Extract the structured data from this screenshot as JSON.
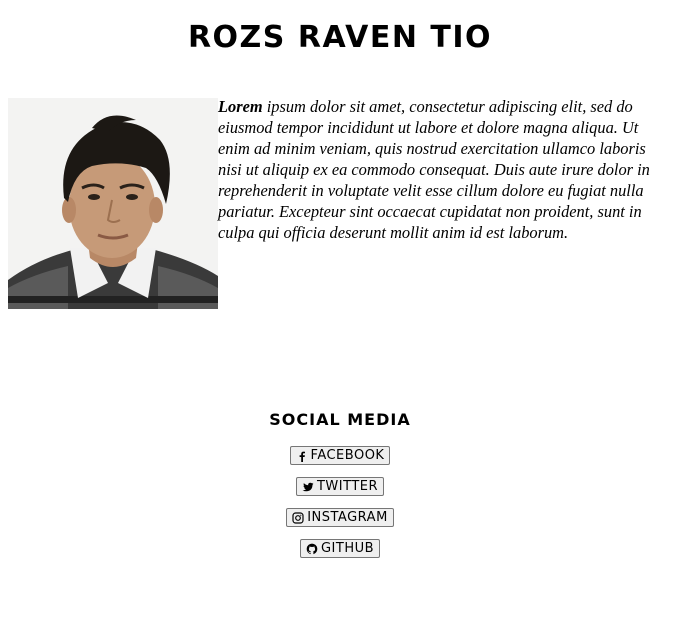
{
  "header": {
    "title": "ROZS RAVEN TIO"
  },
  "profile": {
    "photo_icon": "profile-photo",
    "bio_lead": "Lorem",
    "bio_rest": " ipsum dolor sit amet, consectetur adipiscing elit, sed do eiusmod tempor incididunt ut labore et dolore magna aliqua. Ut enim ad minim veniam, quis nostrud exercitation ullamco laboris nisi ut aliquip ex ea commodo consequat. Duis aute irure dolor in reprehenderit in voluptate velit esse cillum dolore eu fugiat nulla pariatur. Excepteur sint occaecat cupidatat non proident, sunt in culpa qui officia deserunt mollit anim id est laborum."
  },
  "social": {
    "title": "SOCIAL MEDIA",
    "links": [
      {
        "label": "FACEBOOK",
        "icon": "facebook-icon"
      },
      {
        "label": "TWITTER",
        "icon": "twitter-icon"
      },
      {
        "label": "INSTAGRAM",
        "icon": "instagram-icon"
      },
      {
        "label": "GITHUB",
        "icon": "github-icon"
      }
    ]
  }
}
